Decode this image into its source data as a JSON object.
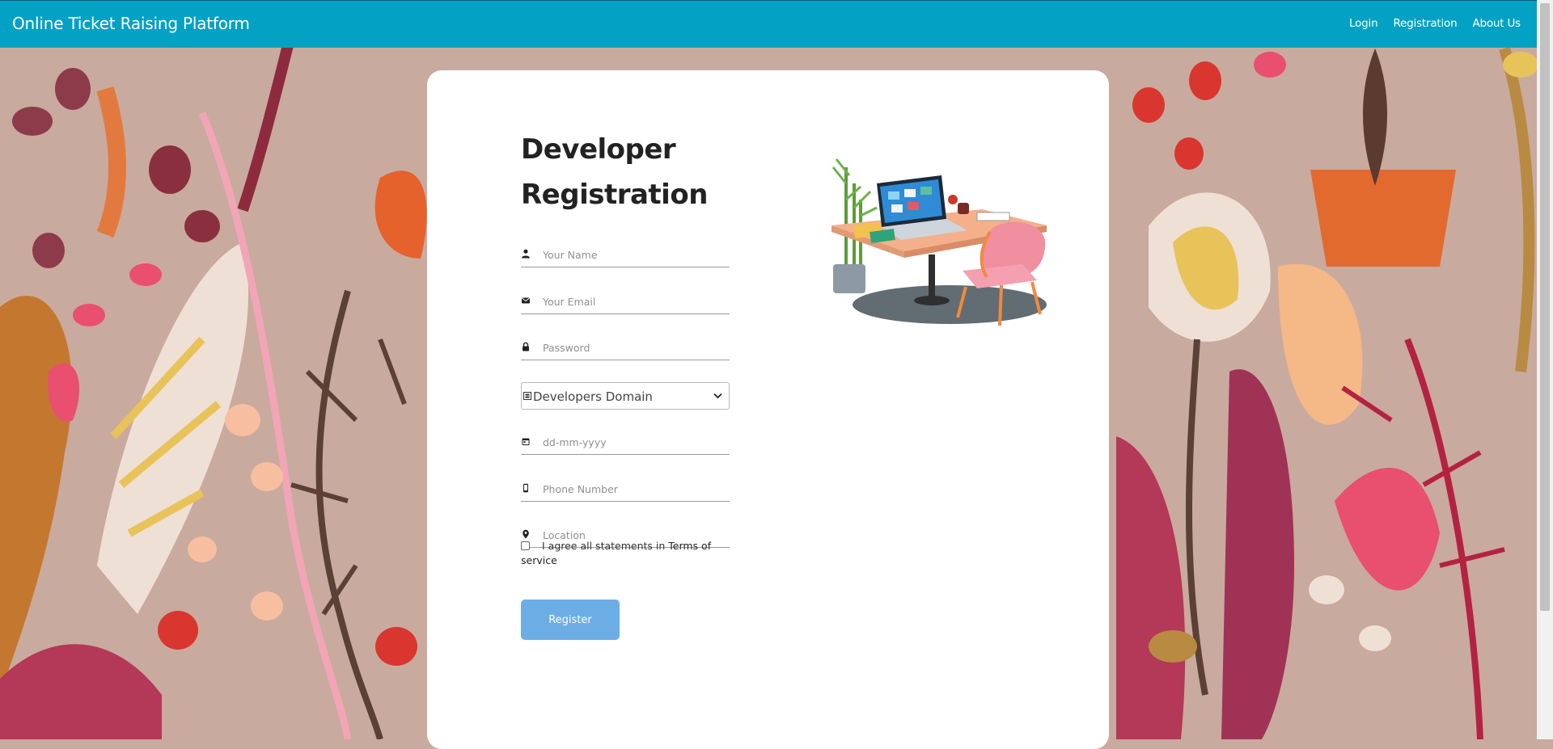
{
  "navbar": {
    "brand": "Online Ticket Raising Platform",
    "links": [
      "Login",
      "Registration",
      "About Us"
    ]
  },
  "form": {
    "title_line1": "Developer",
    "title_line2": "Registration",
    "fields": {
      "name": {
        "placeholder": "Your Name",
        "value": "",
        "icon": "person-icon"
      },
      "email": {
        "placeholder": "Your Email",
        "value": "",
        "icon": "envelope-icon"
      },
      "password": {
        "placeholder": "Password",
        "value": "",
        "icon": "lock-icon"
      },
      "date": {
        "placeholder": "dd-mm-yyyy",
        "value": "",
        "icon": "calendar-icon"
      },
      "phone": {
        "placeholder": "Phone Number",
        "value": "",
        "icon": "mobile-phone-icon"
      },
      "location": {
        "placeholder": "Location",
        "value": "",
        "icon": "map-pin-icon"
      }
    },
    "domain_select": {
      "value": "Developers Domain",
      "icon": "domain-icon"
    },
    "agree": {
      "checked": false,
      "text_before": "I agree all statements in ",
      "terms_link": "Terms of service"
    },
    "register_label": "Register"
  },
  "colors": {
    "navbar": "#03a2c4",
    "register_button": "#6dade6",
    "card": "#ffffff",
    "background": "#c9aa9e"
  }
}
